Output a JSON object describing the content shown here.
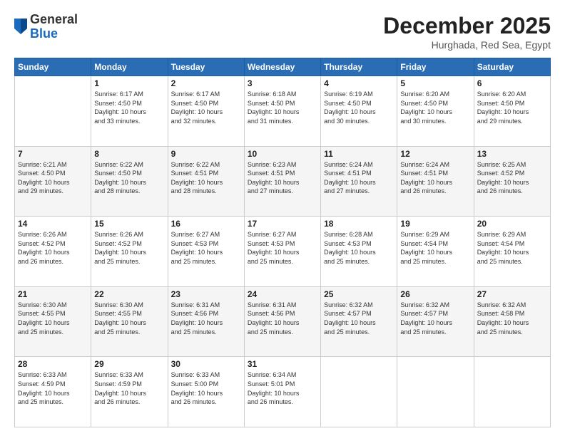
{
  "logo": {
    "general": "General",
    "blue": "Blue"
  },
  "header": {
    "month": "December 2025",
    "location": "Hurghada, Red Sea, Egypt"
  },
  "weekdays": [
    "Sunday",
    "Monday",
    "Tuesday",
    "Wednesday",
    "Thursday",
    "Friday",
    "Saturday"
  ],
  "weeks": [
    [
      {
        "day": "",
        "info": ""
      },
      {
        "day": "1",
        "info": "Sunrise: 6:17 AM\nSunset: 4:50 PM\nDaylight: 10 hours\nand 33 minutes."
      },
      {
        "day": "2",
        "info": "Sunrise: 6:17 AM\nSunset: 4:50 PM\nDaylight: 10 hours\nand 32 minutes."
      },
      {
        "day": "3",
        "info": "Sunrise: 6:18 AM\nSunset: 4:50 PM\nDaylight: 10 hours\nand 31 minutes."
      },
      {
        "day": "4",
        "info": "Sunrise: 6:19 AM\nSunset: 4:50 PM\nDaylight: 10 hours\nand 30 minutes."
      },
      {
        "day": "5",
        "info": "Sunrise: 6:20 AM\nSunset: 4:50 PM\nDaylight: 10 hours\nand 30 minutes."
      },
      {
        "day": "6",
        "info": "Sunrise: 6:20 AM\nSunset: 4:50 PM\nDaylight: 10 hours\nand 29 minutes."
      }
    ],
    [
      {
        "day": "7",
        "info": "Sunrise: 6:21 AM\nSunset: 4:50 PM\nDaylight: 10 hours\nand 29 minutes."
      },
      {
        "day": "8",
        "info": "Sunrise: 6:22 AM\nSunset: 4:50 PM\nDaylight: 10 hours\nand 28 minutes."
      },
      {
        "day": "9",
        "info": "Sunrise: 6:22 AM\nSunset: 4:51 PM\nDaylight: 10 hours\nand 28 minutes."
      },
      {
        "day": "10",
        "info": "Sunrise: 6:23 AM\nSunset: 4:51 PM\nDaylight: 10 hours\nand 27 minutes."
      },
      {
        "day": "11",
        "info": "Sunrise: 6:24 AM\nSunset: 4:51 PM\nDaylight: 10 hours\nand 27 minutes."
      },
      {
        "day": "12",
        "info": "Sunrise: 6:24 AM\nSunset: 4:51 PM\nDaylight: 10 hours\nand 26 minutes."
      },
      {
        "day": "13",
        "info": "Sunrise: 6:25 AM\nSunset: 4:52 PM\nDaylight: 10 hours\nand 26 minutes."
      }
    ],
    [
      {
        "day": "14",
        "info": "Sunrise: 6:26 AM\nSunset: 4:52 PM\nDaylight: 10 hours\nand 26 minutes."
      },
      {
        "day": "15",
        "info": "Sunrise: 6:26 AM\nSunset: 4:52 PM\nDaylight: 10 hours\nand 25 minutes."
      },
      {
        "day": "16",
        "info": "Sunrise: 6:27 AM\nSunset: 4:53 PM\nDaylight: 10 hours\nand 25 minutes."
      },
      {
        "day": "17",
        "info": "Sunrise: 6:27 AM\nSunset: 4:53 PM\nDaylight: 10 hours\nand 25 minutes."
      },
      {
        "day": "18",
        "info": "Sunrise: 6:28 AM\nSunset: 4:53 PM\nDaylight: 10 hours\nand 25 minutes."
      },
      {
        "day": "19",
        "info": "Sunrise: 6:29 AM\nSunset: 4:54 PM\nDaylight: 10 hours\nand 25 minutes."
      },
      {
        "day": "20",
        "info": "Sunrise: 6:29 AM\nSunset: 4:54 PM\nDaylight: 10 hours\nand 25 minutes."
      }
    ],
    [
      {
        "day": "21",
        "info": "Sunrise: 6:30 AM\nSunset: 4:55 PM\nDaylight: 10 hours\nand 25 minutes."
      },
      {
        "day": "22",
        "info": "Sunrise: 6:30 AM\nSunset: 4:55 PM\nDaylight: 10 hours\nand 25 minutes."
      },
      {
        "day": "23",
        "info": "Sunrise: 6:31 AM\nSunset: 4:56 PM\nDaylight: 10 hours\nand 25 minutes."
      },
      {
        "day": "24",
        "info": "Sunrise: 6:31 AM\nSunset: 4:56 PM\nDaylight: 10 hours\nand 25 minutes."
      },
      {
        "day": "25",
        "info": "Sunrise: 6:32 AM\nSunset: 4:57 PM\nDaylight: 10 hours\nand 25 minutes."
      },
      {
        "day": "26",
        "info": "Sunrise: 6:32 AM\nSunset: 4:57 PM\nDaylight: 10 hours\nand 25 minutes."
      },
      {
        "day": "27",
        "info": "Sunrise: 6:32 AM\nSunset: 4:58 PM\nDaylight: 10 hours\nand 25 minutes."
      }
    ],
    [
      {
        "day": "28",
        "info": "Sunrise: 6:33 AM\nSunset: 4:59 PM\nDaylight: 10 hours\nand 25 minutes."
      },
      {
        "day": "29",
        "info": "Sunrise: 6:33 AM\nSunset: 4:59 PM\nDaylight: 10 hours\nand 26 minutes."
      },
      {
        "day": "30",
        "info": "Sunrise: 6:33 AM\nSunset: 5:00 PM\nDaylight: 10 hours\nand 26 minutes."
      },
      {
        "day": "31",
        "info": "Sunrise: 6:34 AM\nSunset: 5:01 PM\nDaylight: 10 hours\nand 26 minutes."
      },
      {
        "day": "",
        "info": ""
      },
      {
        "day": "",
        "info": ""
      },
      {
        "day": "",
        "info": ""
      }
    ]
  ]
}
